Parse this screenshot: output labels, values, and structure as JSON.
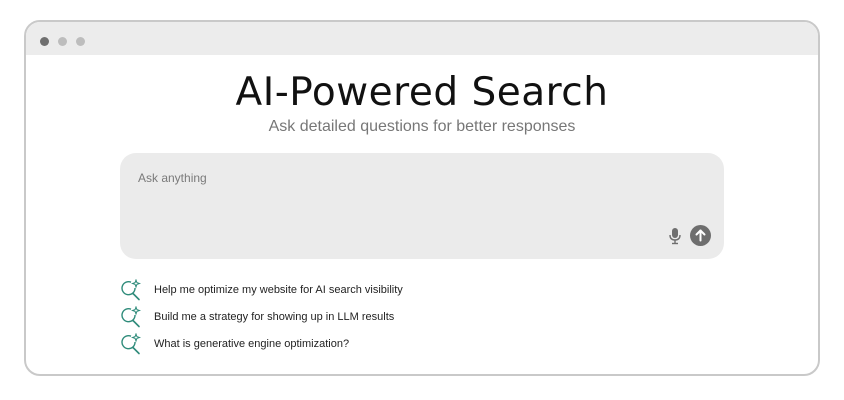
{
  "window": {
    "controls": [
      "close",
      "minimize",
      "maximize"
    ]
  },
  "header": {
    "title": "AI-Powered Search",
    "subtitle": "Ask detailed questions for better responses"
  },
  "search": {
    "placeholder": "Ask anything",
    "value": "",
    "mic_icon": "microphone-icon",
    "send_icon": "arrow-up-icon"
  },
  "suggestions": [
    {
      "icon": "sparkle-search-icon",
      "label": "Help me optimize my website for AI search visibility"
    },
    {
      "icon": "sparkle-search-icon",
      "label": "Build me a strategy for showing up in LLM results"
    },
    {
      "icon": "sparkle-search-icon",
      "label": "What is generative engine optimization?"
    }
  ],
  "colors": {
    "accent": "#2e8b7a",
    "send_button": "#6e6e6e",
    "searchbox_bg": "#ebebeb",
    "titlebar_bg": "#ececec"
  }
}
